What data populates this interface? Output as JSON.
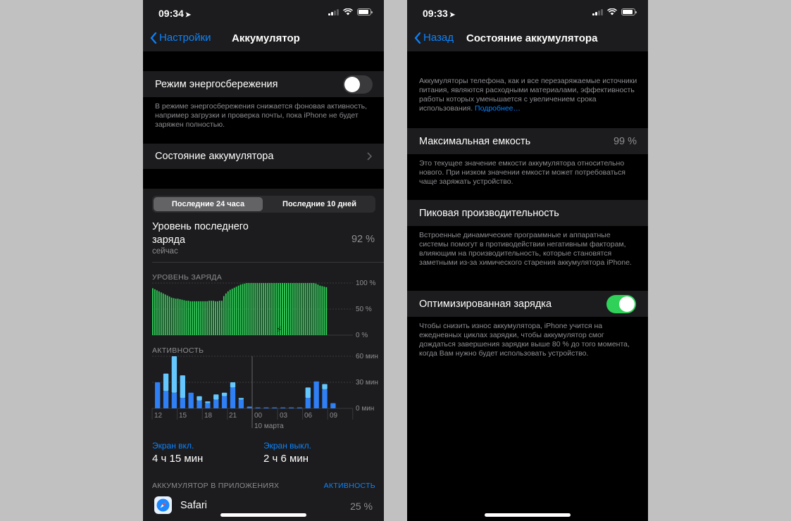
{
  "left": {
    "status": {
      "time": "09:34"
    },
    "nav": {
      "back": "Настройки",
      "title": "Аккумулятор"
    },
    "power_mode": {
      "label": "Режим энергосбережения",
      "enabled": false,
      "footer": "В режиме энергосбережения снижается фоновая активность, например загрузки и проверка почты, пока iPhone не будет заряжен полностью."
    },
    "battery_health_row": {
      "label": "Состояние аккумулятора"
    },
    "segment": {
      "options": [
        "Последние 24 часа",
        "Последние 10 дней"
      ],
      "selected": 0
    },
    "last_charge": {
      "label": "Уровень последнего заряда",
      "sub": "сейчас",
      "value": "92 %"
    },
    "level_chart_title": "УРОВЕНЬ ЗАРЯДА",
    "level_axis": [
      "100 %",
      "50 %",
      "0 %"
    ],
    "activity_chart_title": "АКТИВНОСТЬ",
    "activity_axis": [
      "60 мин",
      "30 мин",
      "0 мин"
    ],
    "x_ticks": [
      "12",
      "15",
      "18",
      "21",
      "00",
      "03",
      "06",
      "09"
    ],
    "date_label": "10 марта",
    "screen_on": {
      "label": "Экран вкл.",
      "value": "4 ч 15 мин"
    },
    "screen_off": {
      "label": "Экран выкл.",
      "value": "2 ч 6 мин"
    },
    "apps_section": {
      "title": "АККУМУЛЯТОР В ПРИЛОЖЕНИЯХ",
      "action": "АКТИВНОСТЬ"
    },
    "apps": [
      {
        "name": "Safari",
        "value": "25 %"
      }
    ]
  },
  "right": {
    "status": {
      "time": "09:33"
    },
    "nav": {
      "back": "Назад",
      "title": "Состояние аккумулятора"
    },
    "intro": "Аккумуляторы телефона, как и все перезаряжаемые источники питания, являются расходными материалами, эффективность работы которых уменьшается с увеличением срока использования.",
    "intro_link": "Подробнее…",
    "max_capacity": {
      "label": "Максимальная емкость",
      "value": "99 %",
      "footer": "Это текущее значение емкости аккумулятора относительно нового. При низком значении емкости может потребоваться чаще заряжать устройство."
    },
    "peak": {
      "label": "Пиковая производительность",
      "footer": "Встроенные динамические программные и аппаратные системы помогут в противодействии негативным факторам, влияющим на производительность, которые становятся заметными из-за химического старения аккумулятора iPhone."
    },
    "optimized": {
      "label": "Оптимизированная зарядка",
      "enabled": true,
      "footer": "Чтобы снизить износ аккумулятора, iPhone учится на ежедневных циклах зарядки, чтобы аккумулятор смог дождаться завершения зарядки выше 80 % до того момента, когда Вам нужно будет использовать устройство."
    }
  },
  "colors": {
    "accent": "#0a84ff",
    "green": "#30d158",
    "bar_dark": "#2f7ff5",
    "bar_light": "#64c8ff",
    "cell": "#1c1c1e"
  },
  "chart_data": [
    {
      "type": "bar",
      "title": "УРОВЕНЬ ЗАРЯДА",
      "x": [
        "12",
        "15",
        "18",
        "21",
        "00",
        "03",
        "06",
        "09"
      ],
      "ylim": [
        0,
        100
      ],
      "y_unit": "%",
      "values": [
        90,
        88,
        86,
        84,
        82,
        80,
        78,
        76,
        74,
        72,
        71,
        70,
        70,
        69,
        68,
        67,
        66,
        66,
        65,
        65,
        65,
        65,
        65,
        65,
        65,
        65,
        65,
        66,
        66,
        66,
        65,
        65,
        66,
        66,
        75,
        80,
        84,
        87,
        89,
        91,
        93,
        95,
        97,
        98,
        99,
        100,
        100,
        100,
        100,
        100,
        100,
        100,
        100,
        100,
        100,
        100,
        100,
        100,
        100,
        100,
        100,
        100,
        100,
        100,
        100,
        100,
        100,
        100,
        100,
        100,
        100,
        100,
        100,
        100,
        100,
        100,
        100,
        100,
        99,
        97,
        95,
        94,
        93,
        92
      ]
    },
    {
      "type": "bar",
      "title": "АКТИВНОСТЬ",
      "x": [
        "12",
        "15",
        "18",
        "21",
        "00",
        "03",
        "06",
        "09"
      ],
      "ylim": [
        0,
        60
      ],
      "y_unit": "мин",
      "series": [
        {
          "name": "Экран вкл.",
          "values": [
            30,
            20,
            18,
            12,
            18,
            9,
            6,
            10,
            14,
            24,
            10,
            2,
            1,
            1,
            1,
            1,
            1,
            1,
            12,
            31,
            22,
            6
          ]
        },
        {
          "name": "Экран выкл.",
          "values": [
            0,
            20,
            42,
            26,
            0,
            5,
            2,
            6,
            4,
            6,
            2,
            0,
            0,
            0,
            0,
            0,
            0,
            0,
            12,
            0,
            6,
            0
          ]
        }
      ]
    }
  ]
}
